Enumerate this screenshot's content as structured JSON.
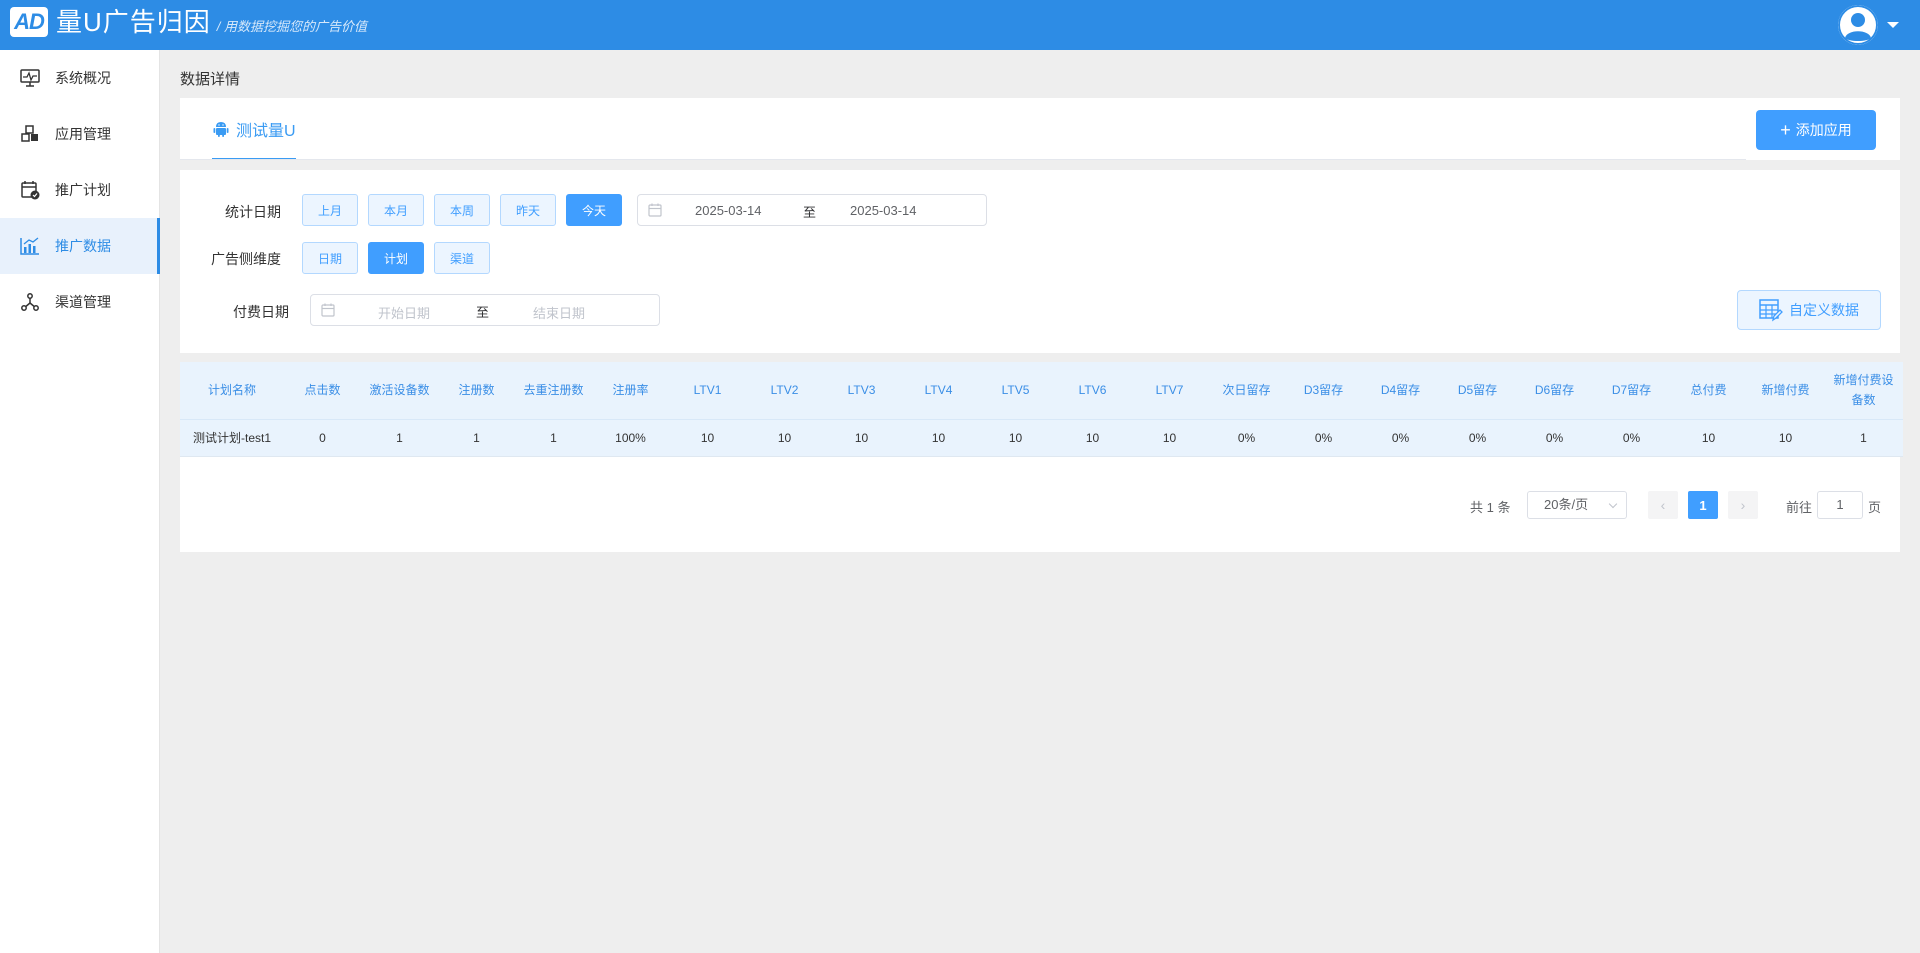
{
  "header": {
    "logo_badge": "AD",
    "logo_title": "量U广告归因",
    "slogan": "/ 用数据挖掘您的广告价值"
  },
  "sidebar": {
    "items": [
      {
        "label": "系统概况",
        "icon": "monitor-icon"
      },
      {
        "label": "应用管理",
        "icon": "cubes-icon"
      },
      {
        "label": "推广计划",
        "icon": "calendar-check-icon"
      },
      {
        "label": "推广数据",
        "icon": "bar-chart-icon",
        "active": true
      },
      {
        "label": "渠道管理",
        "icon": "share-nodes-icon"
      }
    ]
  },
  "page": {
    "title": "数据详情"
  },
  "app_tabs": {
    "active_tab": "测试量U",
    "tab_icon": "android-icon",
    "add_button": "添加应用"
  },
  "filters": {
    "stat_date_label": "统计日期",
    "quick_ranges": [
      "上月",
      "本月",
      "本周",
      "昨天",
      "今天"
    ],
    "active_range": "今天",
    "date_start": "2025-03-14",
    "date_sep": "至",
    "date_end": "2025-03-14",
    "dimension_label": "广告侧维度",
    "dimensions": [
      "日期",
      "计划",
      "渠道"
    ],
    "active_dimension": "计划",
    "pay_date_label": "付费日期",
    "pay_start_placeholder": "开始日期",
    "pay_sep": "至",
    "pay_end_placeholder": "结束日期",
    "custom_button": "自定义数据"
  },
  "table": {
    "columns": [
      "计划名称",
      "点击数",
      "激活设备数",
      "注册数",
      "去重注册数",
      "注册率",
      "LTV1",
      "LTV2",
      "LTV3",
      "LTV4",
      "LTV5",
      "LTV6",
      "LTV7",
      "次日留存",
      "D3留存",
      "D4留存",
      "D5留存",
      "D6留存",
      "D7留存",
      "总付费",
      "新增付费",
      "新增付费设备数"
    ],
    "rows": [
      [
        "测试计划-test1",
        "0",
        "1",
        "1",
        "1",
        "100%",
        "10",
        "10",
        "10",
        "10",
        "10",
        "10",
        "10",
        "0%",
        "0%",
        "0%",
        "0%",
        "0%",
        "0%",
        "10",
        "10",
        "1"
      ]
    ]
  },
  "pagination": {
    "total": "共 1 条",
    "page_size": "20条/页",
    "current_page": "1",
    "goto_label": "前往",
    "goto_value": "1",
    "page_suffix": "页"
  },
  "colors": {
    "header_bg": "#2d8ce5",
    "primary": "#409eff",
    "table_header_bg": "#e9f3fd"
  }
}
